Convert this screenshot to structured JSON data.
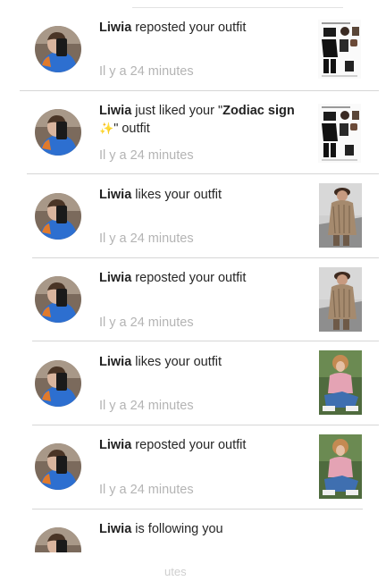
{
  "notifications": [
    {
      "user": "Liwia",
      "action": "reposted your outfit",
      "time": "Il y a 24 minutes",
      "thumb": "collage-icon"
    },
    {
      "user": "Liwia",
      "action_pre": "just liked your \"",
      "outfit_name": "Zodiac sign",
      "sparkle": "✨",
      "action_post": "\" outfit",
      "time": "Il y a 24 minutes",
      "thumb": "collage-icon"
    },
    {
      "user": "Liwia",
      "action": "likes your outfit",
      "time": "Il y a 24 minutes",
      "thumb": "sweater-photo-icon"
    },
    {
      "user": "Liwia",
      "action": "reposted your outfit",
      "time": "Il y a 24 minutes",
      "thumb": "sweater-photo-icon"
    },
    {
      "user": "Liwia",
      "action": "likes your outfit",
      "time": "Il y a 24 minutes",
      "thumb": "pink-sweater-photo-icon"
    },
    {
      "user": "Liwia",
      "action": "reposted your outfit",
      "time": "Il y a 24 minutes",
      "thumb": "pink-sweater-photo-icon"
    },
    {
      "user": "Liwia",
      "action": "is following you"
    }
  ],
  "footer_partial": "utes",
  "colors": {
    "text": "#262626",
    "time": "#b4b4b4",
    "divider": "#d6d6d6",
    "avatar_blue": "#2d6fd0"
  }
}
